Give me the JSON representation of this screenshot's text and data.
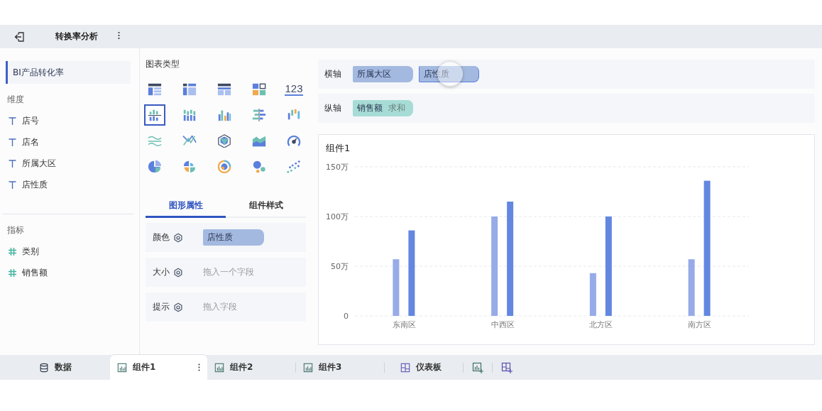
{
  "header": {
    "title": "转换率分析"
  },
  "dataset": {
    "name": "BI产品转化率"
  },
  "dimensions": {
    "title": "维度",
    "fields": [
      {
        "label": "店号"
      },
      {
        "label": "店名"
      },
      {
        "label": "所属大区"
      },
      {
        "label": "店性质"
      }
    ]
  },
  "measures": {
    "title": "指标",
    "fields": [
      {
        "label": "类别"
      },
      {
        "label": "销售额"
      }
    ]
  },
  "chart_types": {
    "title": "图表类型",
    "items": [
      {
        "kind": "table",
        "selected": false
      },
      {
        "kind": "cross-table",
        "selected": false
      },
      {
        "kind": "detail-table",
        "selected": false
      },
      {
        "kind": "card-grid",
        "selected": false
      },
      {
        "kind": "number",
        "label": "123",
        "selected": false
      },
      {
        "kind": "grouped-bar",
        "selected": true
      },
      {
        "kind": "stacked-bar",
        "selected": false
      },
      {
        "kind": "multi-bar",
        "selected": false
      },
      {
        "kind": "diverging-bar",
        "selected": false
      },
      {
        "kind": "range-bar",
        "selected": false
      },
      {
        "kind": "line",
        "selected": false
      },
      {
        "kind": "cross-line",
        "selected": false
      },
      {
        "kind": "radar",
        "selected": false
      },
      {
        "kind": "area",
        "selected": false
      },
      {
        "kind": "gauge",
        "selected": false
      },
      {
        "kind": "pie",
        "selected": false
      },
      {
        "kind": "rose",
        "selected": false
      },
      {
        "kind": "sunburst",
        "selected": false
      },
      {
        "kind": "bubble",
        "selected": false
      },
      {
        "kind": "scatter",
        "selected": false
      }
    ]
  },
  "property_tabs": [
    {
      "label": "图形属性",
      "selected": true
    },
    {
      "label": "组件样式",
      "selected": false
    }
  ],
  "properties": [
    {
      "label": "颜色",
      "field": "店性质"
    },
    {
      "label": "大小",
      "placeholder": "拖入一个字段"
    },
    {
      "label": "提示",
      "placeholder": "拖入字段"
    }
  ],
  "axes": [
    {
      "label": "横轴",
      "fields": [
        {
          "name": "所属大区",
          "kind": "dimension",
          "dragging": false
        },
        {
          "name": "店性质",
          "kind": "dimension",
          "dragging": true
        }
      ]
    },
    {
      "label": "纵轴",
      "fields": [
        {
          "name": "销售额",
          "aggregation": "求和",
          "kind": "measure",
          "dragging": false
        }
      ]
    }
  ],
  "chart": {
    "title": "组件1",
    "chart_data": {
      "type": "bar",
      "categories": [
        "东南区",
        "中西区",
        "北方区",
        "南方区"
      ],
      "series": [
        {
          "color": "#97abe8",
          "values": [
            57,
            100,
            43,
            57
          ]
        },
        {
          "color": "#6387e0",
          "values": [
            86,
            115,
            100,
            136
          ]
        }
      ],
      "ylim": [
        0,
        150
      ],
      "yticks": [
        {
          "value": 0,
          "label": "0"
        },
        {
          "value": 50,
          "label": "50万"
        },
        {
          "value": 100,
          "label": "100万"
        },
        {
          "value": 150,
          "label": "150万"
        }
      ]
    }
  },
  "bottom_tabs": [
    {
      "label": "数据",
      "kind": "data",
      "selected": false
    },
    {
      "label": "组件1",
      "kind": "component",
      "selected": true
    },
    {
      "label": "组件2",
      "kind": "component",
      "selected": false
    },
    {
      "label": "组件3",
      "kind": "component",
      "selected": false
    },
    {
      "label": "仪表板",
      "kind": "dashboard",
      "selected": false
    }
  ]
}
